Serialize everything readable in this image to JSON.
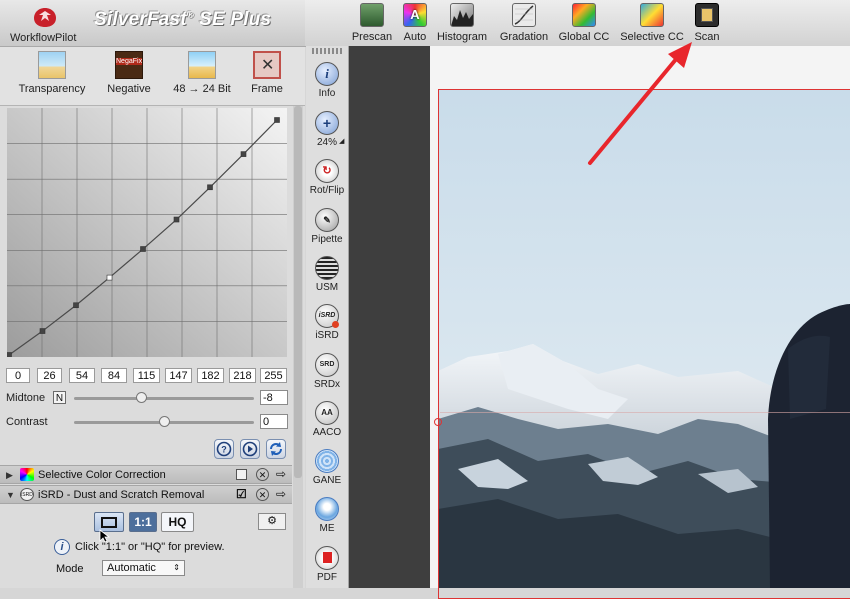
{
  "header": {
    "workflow_label": "WorkflowPilot",
    "title_main": "SilverFast",
    "title_reg": "®",
    "title_suffix": "SE Plus"
  },
  "panel_toolbar": [
    {
      "label": "Transparency",
      "icon": "transparency-icon"
    },
    {
      "label": "Negative",
      "icon": "negafix-icon",
      "badge": "NegaFix"
    },
    {
      "label": "48 → 24 Bit",
      "icon": "bit-depth-icon"
    },
    {
      "label": "Frame",
      "icon": "frame-tools-icon"
    }
  ],
  "curve_values": [
    "0",
    "26",
    "54",
    "84",
    "115",
    "147",
    "182",
    "218",
    "255"
  ],
  "midtone": {
    "label": "Midtone",
    "button": "N",
    "value": "-8",
    "level": 0.37
  },
  "contrast": {
    "label": "Contrast",
    "value": "0",
    "level": 0.5
  },
  "sections": [
    {
      "label": "Selective Color Correction",
      "expanded": false
    },
    {
      "label": "iSRD - Dust and Scratch Removal",
      "expanded": true
    }
  ],
  "isrd": {
    "btn_full": "",
    "btn_1to1": "1:1",
    "btn_hq": "HQ",
    "hint": "Click \"1:1\" or \"HQ\" for preview.",
    "mode_label": "Mode",
    "mode_value": "Automatic"
  },
  "main_toolbar": [
    {
      "label": "Prescan",
      "icon": "prescan-icon"
    },
    {
      "label": "Auto",
      "icon": "auto-icon",
      "glyph": "A"
    },
    {
      "label": "Histogram",
      "icon": "histogram-icon"
    },
    {
      "label": "Gradation",
      "icon": "gradation-icon"
    },
    {
      "label": "Global CC",
      "icon": "global-cc-icon"
    },
    {
      "label": "Selective CC",
      "icon": "selective-cc-icon"
    },
    {
      "label": "Scan",
      "icon": "scan-icon"
    }
  ],
  "vertical_tools": [
    {
      "label": "Info",
      "icon": "info-icon",
      "glyph": "i"
    },
    {
      "label": "24%",
      "icon": "zoom-icon",
      "glyph": "+"
    },
    {
      "label": "Rot/Flip",
      "icon": "rotate-flip-icon",
      "glyph": ""
    },
    {
      "label": "Pipette",
      "icon": "pipette-icon",
      "glyph": ""
    },
    {
      "label": "USM",
      "icon": "usm-icon",
      "glyph": ""
    },
    {
      "label": "iSRD",
      "icon": "isrd-icon",
      "glyph": "iSRD"
    },
    {
      "label": "SRDx",
      "icon": "srdx-icon",
      "glyph": "SRD"
    },
    {
      "label": "AACO",
      "icon": "aaco-icon",
      "glyph": "AA"
    },
    {
      "label": "GANE",
      "icon": "gane-icon",
      "glyph": ""
    },
    {
      "label": "ME",
      "icon": "me-icon",
      "glyph": ""
    },
    {
      "label": "PDF",
      "icon": "pdf-icon",
      "glyph": ""
    }
  ],
  "colors": {
    "accent_red": "#e8262c",
    "frame_red": "#dd3333",
    "isrd_blue": "#7fb3e8"
  }
}
